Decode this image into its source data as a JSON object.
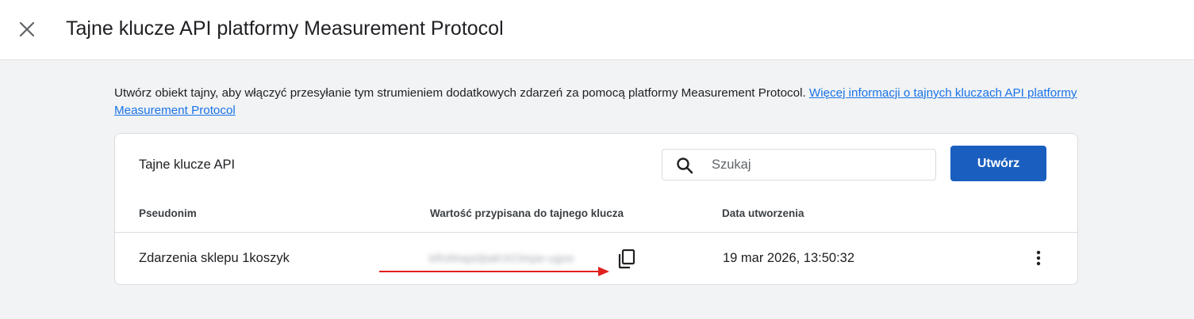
{
  "header": {
    "title": "Tajne klucze API platformy Measurement Protocol",
    "close_icon": "close-icon"
  },
  "description": {
    "text": "Utwórz obiekt tajny, aby włączyć przesyłanie tym strumieniem dodatkowych zdarzeń za pomocą platformy Measurement Protocol. ",
    "link_text": "Więcej informacji o tajnych kluczach API platformy Measurement Protocol"
  },
  "card": {
    "title": "Tajne klucze API",
    "search_placeholder": "Szukaj",
    "create_label": "Utwórz",
    "columns": {
      "nickname": "Pseudonim",
      "secret_value": "Wartość przypisana do tajnego klucza",
      "created": "Data utworzenia"
    },
    "rows": [
      {
        "nickname": "Zdarzenia sklepu 1koszyk",
        "secret_value": "kRsfmqs0jtaKXClmpe-ugxe",
        "created": "19 mar 2026, 13:50:32"
      }
    ]
  },
  "colors": {
    "accent": "#1a5fbf",
    "link": "#1a73e8",
    "annotation_arrow": "#e02020"
  }
}
